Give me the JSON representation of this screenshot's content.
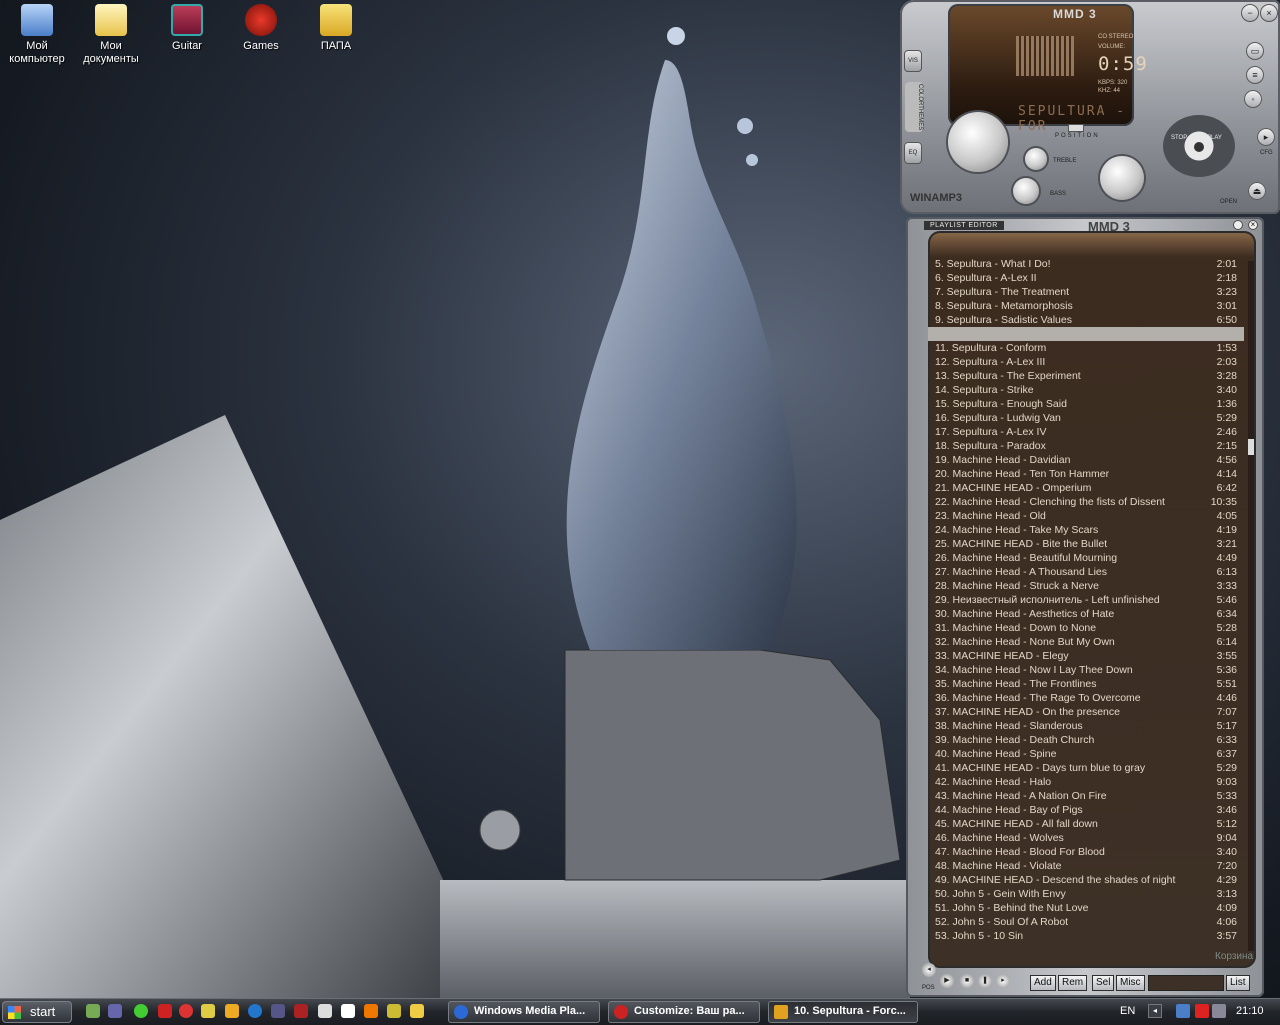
{
  "desktop_icons": [
    {
      "label": "Мой компьютер",
      "icon": "my-computer-icon"
    },
    {
      "label": "Мои документы",
      "icon": "my-documents-icon"
    },
    {
      "label": "Guitar",
      "icon": "guitar-icon"
    },
    {
      "label": "Games",
      "icon": "games-icon"
    },
    {
      "label": "ПАПА",
      "icon": "folder-icon"
    }
  ],
  "player": {
    "logo": "MMD 3",
    "brand": "WINAMP3",
    "stereo": "CO STEREO",
    "volume_label": "VOLUME:",
    "time": "0:59",
    "kbps": "KBPS: 320",
    "khz": "KHZ: 44",
    "track_scroll": "SEPULTURA - FOR",
    "position_label": "POSITION",
    "treble_label": "TREBLE",
    "bass_label": "BASS",
    "vis_label": "VIS",
    "colorthemes_label": "COLORTHEMES",
    "eq_label": "EQ",
    "stop_label": "STOP",
    "play_label": "PLAY",
    "cfg_label": "CFG",
    "open_label": "OPEN"
  },
  "playlist": {
    "header": "PLAYLIST EDITOR",
    "logo": "MMD 3",
    "buttons": {
      "add": "Add",
      "rem": "Rem",
      "sel": "Sel",
      "misc": "Misc",
      "list": "List"
    },
    "pos_label": "POS",
    "trash": "Корзина",
    "rows": [
      {
        "title": "5. Sepultura - What I Do!",
        "duration": "2:01"
      },
      {
        "title": "6. Sepultura - A-Lex II",
        "duration": "2:18"
      },
      {
        "title": "7. Sepultura - The Treatment",
        "duration": "3:23"
      },
      {
        "title": "8. Sepultura - Metamorphosis",
        "duration": "3:01"
      },
      {
        "title": "9. Sepultura - Sadistic Values",
        "duration": "6:50"
      },
      {
        "title": "",
        "duration": "",
        "selected": true
      },
      {
        "title": "11. Sepultura - Conform",
        "duration": "1:53"
      },
      {
        "title": "12. Sepultura - A-Lex III",
        "duration": "2:03"
      },
      {
        "title": "13. Sepultura - The Experiment",
        "duration": "3:28"
      },
      {
        "title": "14. Sepultura - Strike",
        "duration": "3:40"
      },
      {
        "title": "15. Sepultura - Enough Said",
        "duration": "1:36"
      },
      {
        "title": "16. Sepultura - Ludwig Van",
        "duration": "5:29"
      },
      {
        "title": "17. Sepultura - A-Lex IV",
        "duration": "2:46"
      },
      {
        "title": "18. Sepultura - Paradox",
        "duration": "2:15"
      },
      {
        "title": "19. Machine Head - Davidian",
        "duration": "4:56"
      },
      {
        "title": "20. Machine Head - Ten Ton Hammer",
        "duration": "4:14"
      },
      {
        "title": "21. MACHINE HEAD - Omperium",
        "duration": "6:42"
      },
      {
        "title": "22. Machine Head - Clenching the fists of Dissent",
        "duration": "10:35"
      },
      {
        "title": "23. Machine Head - Old",
        "duration": "4:05"
      },
      {
        "title": "24. Machine Head - Take My Scars",
        "duration": "4:19"
      },
      {
        "title": "25. MACHINE HEAD - Bite the Bullet",
        "duration": "3:21"
      },
      {
        "title": "26. Machine Head - Beautiful Mourning",
        "duration": "4:49"
      },
      {
        "title": "27. Machine Head - A Thousand Lies",
        "duration": "6:13"
      },
      {
        "title": "28. Machine Head - Struck a Nerve",
        "duration": "3:33"
      },
      {
        "title": "29. Неизвестный исполнитель - Left unfinished",
        "duration": "5:46"
      },
      {
        "title": "30. Machine Head - Aesthetics of Hate",
        "duration": "6:34"
      },
      {
        "title": "31. Machine Head - Down to None",
        "duration": "5:28"
      },
      {
        "title": "32. Machine Head - None But My Own",
        "duration": "6:14"
      },
      {
        "title": "33. MACHINE HEAD - Elegy",
        "duration": "3:55"
      },
      {
        "title": "34. Machine Head - Now I Lay Thee Down",
        "duration": "5:36"
      },
      {
        "title": "35. Machine Head - The Frontlines",
        "duration": "5:51"
      },
      {
        "title": "36. Machine Head - The Rage To Overcome",
        "duration": "4:46"
      },
      {
        "title": "37. MACHINE HEAD - On the presence",
        "duration": "7:07"
      },
      {
        "title": "38. Machine Head - Slanderous",
        "duration": "5:17"
      },
      {
        "title": "39. Machine Head - Death Church",
        "duration": "6:33"
      },
      {
        "title": "40. Machine Head - Spine",
        "duration": "6:37"
      },
      {
        "title": "41. MACHINE HEAD - Days turn blue to gray",
        "duration": "5:29"
      },
      {
        "title": "42. Machine Head - Halo",
        "duration": "9:03"
      },
      {
        "title": "43. Machine Head - A Nation On Fire",
        "duration": "5:33"
      },
      {
        "title": "44. Machine Head - Bay of Pigs",
        "duration": "3:46"
      },
      {
        "title": "45. MACHINE HEAD - All fall down",
        "duration": "5:12"
      },
      {
        "title": "46. Machine Head - Wolves",
        "duration": "9:04"
      },
      {
        "title": "47. Machine Head - Blood For Blood",
        "duration": "3:40"
      },
      {
        "title": "48. Machine Head - Violate",
        "duration": "7:20"
      },
      {
        "title": "49. MACHINE HEAD - Descend the shades of night",
        "duration": "4:29"
      },
      {
        "title": "50. John 5 - Gein With Envy",
        "duration": "3:13"
      },
      {
        "title": "51. John 5 - Behind the Nut Love",
        "duration": "4:09"
      },
      {
        "title": "52. John 5 - Soul Of A Robot",
        "duration": "4:06"
      },
      {
        "title": "53. John 5 - 10 Sin",
        "duration": "3:57"
      }
    ]
  },
  "taskbar": {
    "start_label": "start",
    "tasks": [
      {
        "label": "Windows Media Pla...",
        "icon": "windows-media-player-icon",
        "color": "#2b6ad6"
      },
      {
        "label": "Customize: Ваш ра...",
        "icon": "opera-icon",
        "color": "#cc2222"
      },
      {
        "label": "10. Sepultura - Forc...",
        "icon": "winamp-icon",
        "color": "#e0a020",
        "active": true
      }
    ],
    "language": "EN",
    "clock": "21:10"
  }
}
